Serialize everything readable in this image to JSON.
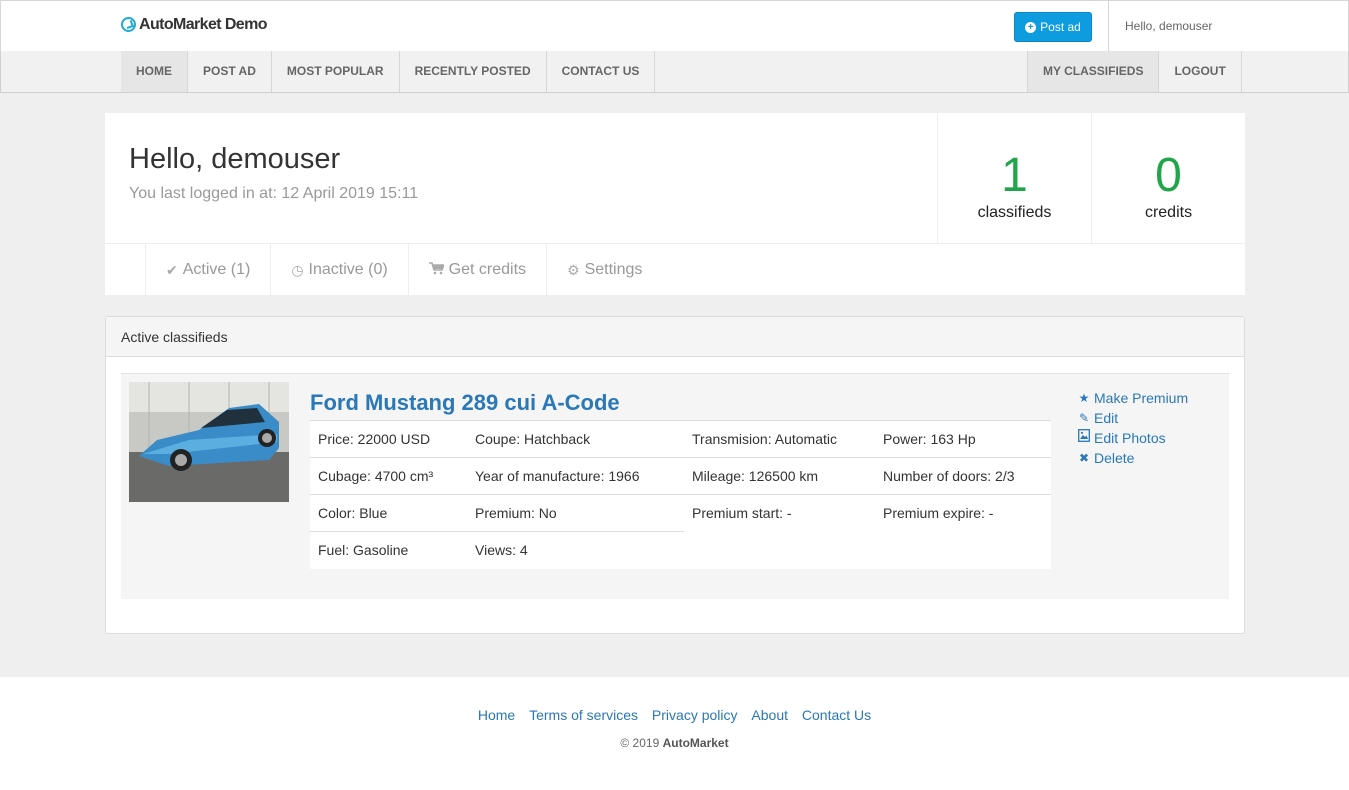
{
  "header": {
    "brand": "AutoMarket Demo",
    "post_ad_label": "Post ad",
    "greeting": "Hello, demouser"
  },
  "nav": {
    "left": [
      "HOME",
      "POST AD",
      "MOST POPULAR",
      "RECENTLY POSTED",
      "CONTACT US"
    ],
    "right": [
      "MY CLASSIFIEDS",
      "LOGOUT"
    ]
  },
  "profile": {
    "title": "Hello, demouser",
    "last_login": "You last logged in at: 12 April 2019 15:11",
    "stats": [
      {
        "value": "1",
        "label": "classifieds"
      },
      {
        "value": "0",
        "label": "credits"
      }
    ],
    "tabs": [
      {
        "icon": "check-icon",
        "label": "Active (1)"
      },
      {
        "icon": "clock-icon",
        "label": "Inactive (0)"
      },
      {
        "icon": "cart-icon",
        "label": "Get credits"
      },
      {
        "icon": "gears-icon",
        "label": "Settings"
      }
    ]
  },
  "panel": {
    "title": "Active classifieds",
    "listing": {
      "title": "Ford Mustang 289 cui A-Code",
      "image_alt": "photo of a blue Ford Mustang",
      "specs": [
        [
          "Price: 22000 USD",
          "Coupe: Hatchback",
          "Transmision: Automatic",
          "Power: 163 Hp"
        ],
        [
          "Cubage: 4700 cm³",
          "Year of manufacture: 1966",
          "Mileage: 126500 km",
          "Number of doors: 2/3"
        ],
        [
          "Color: Blue",
          "Premium: No",
          "Premium start: -",
          "Premium expire: -"
        ],
        [
          "Fuel: Gasoline",
          "Views: 4",
          "",
          ""
        ]
      ],
      "actions": [
        {
          "icon": "star-icon",
          "label": "Make Premium"
        },
        {
          "icon": "pencil-icon",
          "label": "Edit"
        },
        {
          "icon": "image-icon",
          "label": "Edit Photos"
        },
        {
          "icon": "times-icon",
          "label": "Delete"
        }
      ]
    }
  },
  "footer": {
    "links": [
      "Home",
      "Terms of services",
      "Privacy policy",
      "About",
      "Contact Us"
    ],
    "copyright_prefix": "© 2019 ",
    "copyright_brand": "AutoMarket"
  },
  "colors": {
    "accent": "#2a78b8",
    "button": "#0d9ce0",
    "stat": "#21a54a"
  }
}
